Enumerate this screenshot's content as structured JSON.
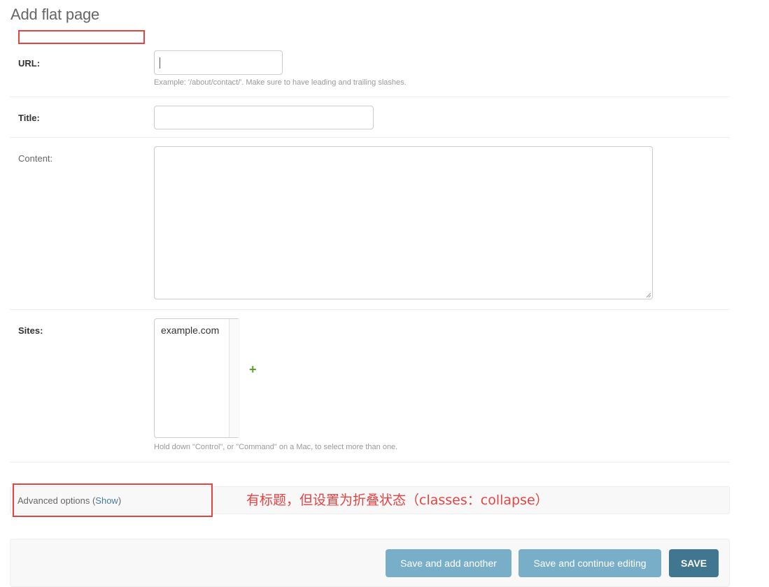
{
  "page": {
    "title": "Add flat page"
  },
  "form": {
    "url": {
      "label": "URL:",
      "value": "",
      "help": "Example: '/about/contact/'. Make sure to have leading and trailing slashes."
    },
    "title": {
      "label": "Title:",
      "value": ""
    },
    "content": {
      "label": "Content:",
      "value": ""
    },
    "sites": {
      "label": "Sites:",
      "options": [
        "example.com"
      ],
      "add_icon": "+",
      "help": "Hold down \"Control\", or \"Command\" on a Mac, to select more than one."
    }
  },
  "advanced": {
    "legend_prefix": "Advanced options (",
    "show_link": "Show",
    "legend_suffix": ")"
  },
  "annotation": {
    "note": "有标题，但设置为折叠状态（classes：collapse）",
    "color": "#e84343"
  },
  "submit": {
    "save_add_another": "Save and add another",
    "save_continue": "Save and continue editing",
    "save": "SAVE"
  },
  "colors": {
    "primary_button": "#417690",
    "secondary_button": "#79aec8",
    "link": "#447e9b",
    "add_icon": "#5aa02c"
  }
}
